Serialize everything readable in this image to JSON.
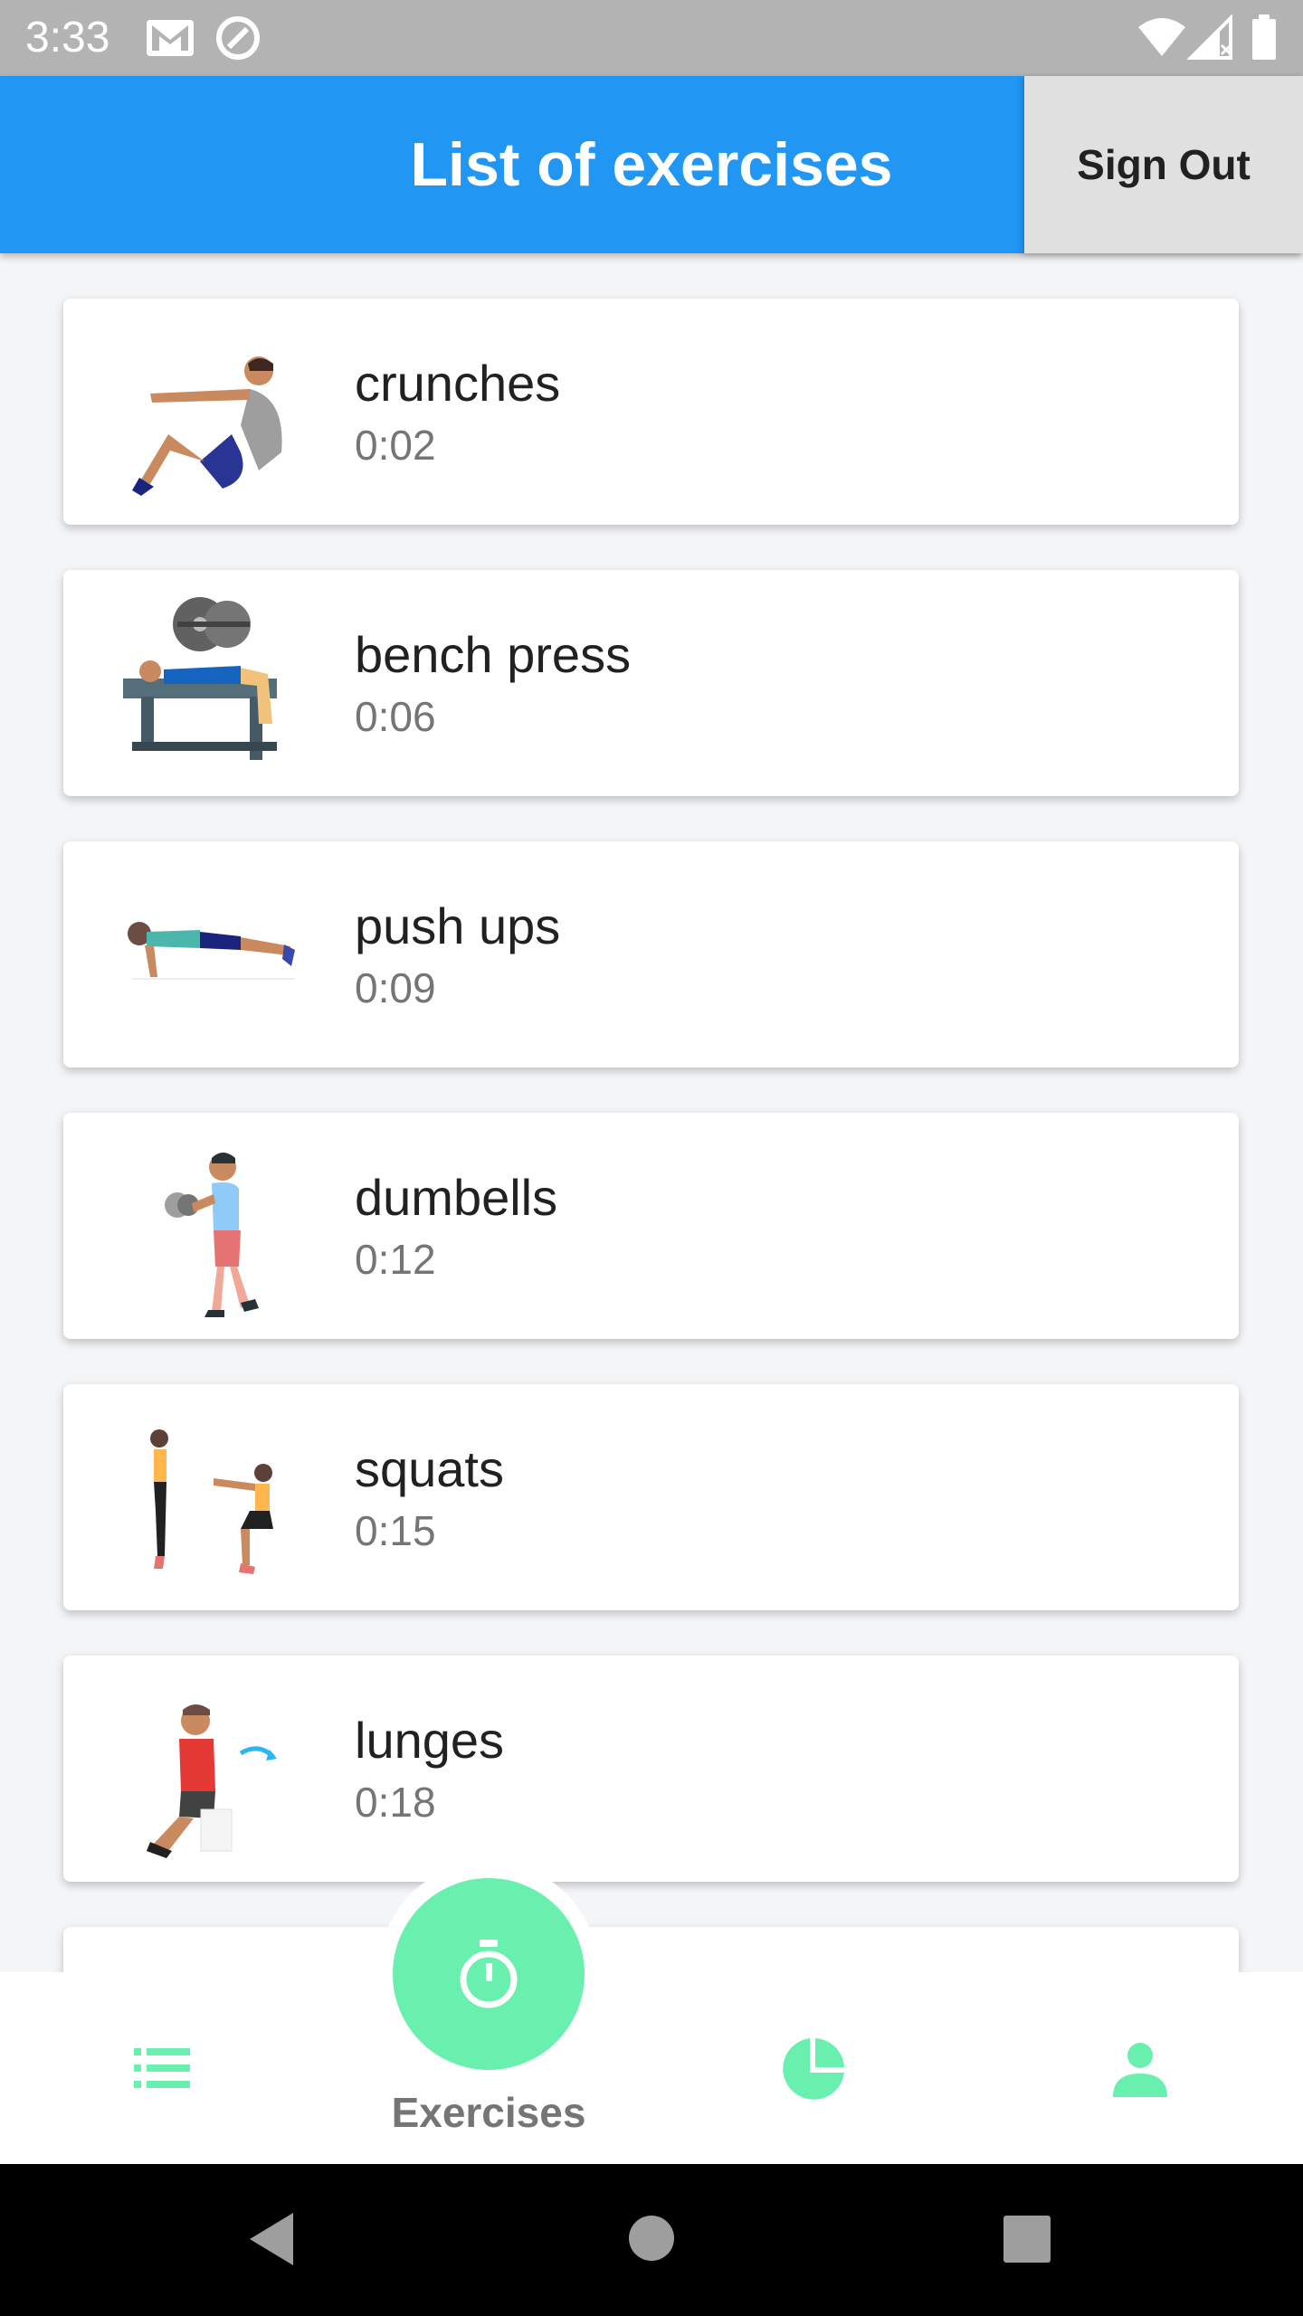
{
  "status_bar": {
    "time": "3:33",
    "icons": [
      "gmail-icon",
      "sync-icon",
      "wifi-icon",
      "signal-icon",
      "battery-icon"
    ]
  },
  "app_bar": {
    "title": "List of exercises",
    "sign_out_label": "Sign Out",
    "color": "#2196f3"
  },
  "exercises": [
    {
      "name": "crunches",
      "time": "0:02",
      "icon": "crunches-illustration"
    },
    {
      "name": "bench press",
      "time": "0:06",
      "icon": "bench-press-illustration"
    },
    {
      "name": "push ups",
      "time": "0:09",
      "icon": "push-ups-illustration"
    },
    {
      "name": "dumbells",
      "time": "0:12",
      "icon": "dumbells-illustration"
    },
    {
      "name": "squats",
      "time": "0:15",
      "icon": "squats-illustration"
    },
    {
      "name": "lunges",
      "time": "0:18",
      "icon": "lunges-illustration"
    }
  ],
  "bottom_nav": {
    "active_label": "Exercises",
    "accent": "#69f0ae",
    "items": [
      "list-icon",
      "timer-icon",
      "pie-chart-icon",
      "person-icon"
    ]
  },
  "system_nav": {
    "items": [
      "back-icon",
      "home-icon",
      "recents-icon"
    ]
  }
}
